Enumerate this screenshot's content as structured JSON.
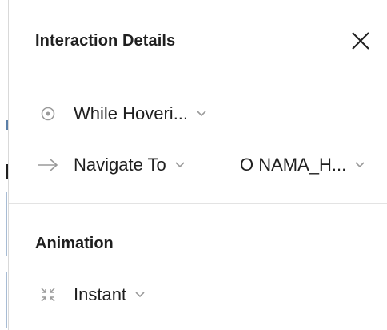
{
  "panel": {
    "title": "Interaction Details",
    "close_icon": "close-icon"
  },
  "trigger": {
    "icon": "hover-target-icon",
    "value": "While Hoveri..."
  },
  "action": {
    "icon": "arrow-right-icon",
    "value": "Navigate To",
    "destination": "O NAMA_H..."
  },
  "animation": {
    "title": "Animation",
    "icon": "instant-transition-icon",
    "value": "Instant"
  },
  "colors": {
    "text": "#1f1f1f",
    "icon_muted": "#9a9a9a",
    "divider": "#e3e3e3"
  }
}
